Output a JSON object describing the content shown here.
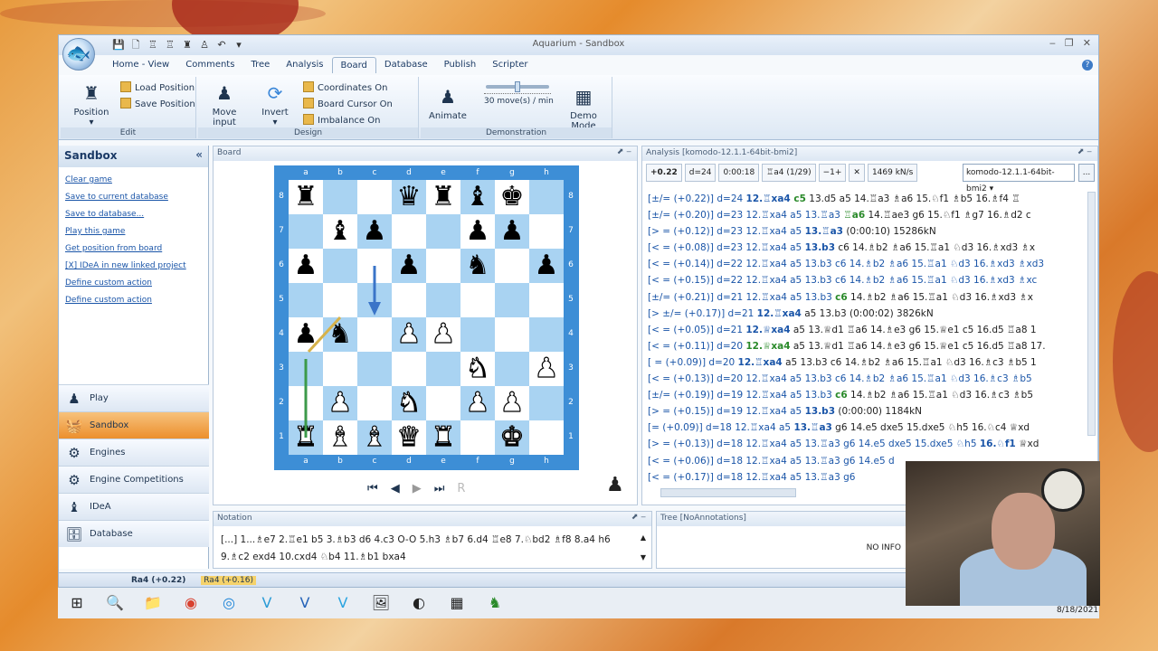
{
  "window": {
    "title": "Aquarium - Sandbox",
    "min": "‒",
    "max": "❐",
    "close": "✕"
  },
  "quick_access": [
    "💾",
    "🗋",
    "♖",
    "♖",
    "♜",
    "♙",
    "↶",
    "▾"
  ],
  "tabs": [
    "Home - View",
    "Comments",
    "Tree",
    "Analysis",
    "Board",
    "Database",
    "Publish",
    "Scripter"
  ],
  "active_tab": "Board",
  "ribbon": {
    "edit": {
      "label": "Edit",
      "position": "Position",
      "load": "Load Position",
      "save": "Save Position"
    },
    "design": {
      "label": "Design",
      "move_input": "Move input",
      "invert": "Invert",
      "coords": "Coordinates On",
      "cursor": "Board Cursor On",
      "imbalance": "Imbalance On"
    },
    "demonstration": {
      "label": "Demonstration",
      "animate": "Animate",
      "speed": "30 move(s) / min",
      "speed_fraction": 0.5,
      "demo": "Demo Mode"
    }
  },
  "sidebar": {
    "title": "Sandbox",
    "tasks": [
      "Clear game",
      "Save to current database",
      "Save to database...",
      "Play this game",
      "Get position from board",
      "[X] IDeA in new linked project",
      "Define custom action",
      "Define custom action"
    ],
    "nav": [
      {
        "label": "Play",
        "icon": "♟"
      },
      {
        "label": "Sandbox",
        "icon": "🧺"
      },
      {
        "label": "Engines",
        "icon": "⚙"
      },
      {
        "label": "Engine Competitions",
        "icon": "⚙"
      },
      {
        "label": "IDeA",
        "icon": "♝"
      },
      {
        "label": "Database",
        "icon": "🗄"
      }
    ]
  },
  "board_panel": {
    "title": "Board",
    "files": [
      "a",
      "b",
      "c",
      "d",
      "e",
      "f",
      "g",
      "h"
    ],
    "ranks": [
      "8",
      "7",
      "6",
      "5",
      "4",
      "3",
      "2",
      "1"
    ],
    "position": [
      [
        "r",
        "",
        "",
        "q",
        "r",
        "b",
        "k",
        ""
      ],
      [
        "",
        "b",
        "p",
        "",
        "",
        "p",
        "p",
        ""
      ],
      [
        "p",
        "",
        "",
        "p",
        "",
        "n",
        "",
        "p"
      ],
      [
        "",
        "",
        "",
        "",
        "",
        "",
        "",
        ""
      ],
      [
        "p",
        "n",
        "",
        "P",
        "P",
        "",
        "",
        ""
      ],
      [
        "",
        "",
        "",
        "",
        "",
        "N",
        "",
        "P"
      ],
      [
        "",
        "P",
        "",
        "N",
        "",
        "P",
        "P",
        ""
      ],
      [
        "R",
        "B",
        "B",
        "Q",
        "R",
        "",
        "K",
        ""
      ]
    ],
    "nav": [
      "⏮",
      "◀",
      "▶",
      "⏭",
      "R"
    ]
  },
  "analysis": {
    "title": "Analysis [komodo-12.1.1-64bit-bmi2]",
    "score": "+0.22",
    "depth": "d=24",
    "time": "0:00:18",
    "move": "♖a4 (1/29)",
    "eval": "−1+",
    "close": "✕",
    "speed": "1469 kN/s",
    "engine": "komodo-12.1.1-64bit-bmi2 ▾",
    "more": "...",
    "lines": [
      [
        "[±/= (+0.22)] d=24 ",
        "12.♖xa4 ",
        "c5",
        " 13.d5 a5 14.♖a3 ♗a6 15.♘f1 ♗b5 16.♗f4 ♖"
      ],
      [
        "[±/= (+0.20)] d=23 12.♖xa4 a5 13.♖a3 ",
        "",
        "♖a6",
        " 14.♖ae3 g6 15.♘f1 ♗g7 16.♗d2 c"
      ],
      [
        "[> = (+0.12)] d=23 12.♖xa4 a5 ",
        "13.♖a3",
        "",
        "",
        " (0:00:10) 15286kN"
      ],
      [
        "[< = (+0.08)] d=23 12.♖xa4 a5 ",
        "13.b3",
        "",
        "",
        " c6 14.♗b2 ♗a6 15.♖a1 ♘d3 16.♗xd3 ♗x"
      ],
      [
        "[< = (+0.14)] d=22 12.♖xa4 a5 13.b3 c6 14.♗b2 ♗a6 15.♖a1 ♘d3 16.♗xd3 ♗xd3",
        "",
        "",
        ""
      ],
      [
        "[< = (+0.15)] d=22 12.♖xa4 a5 13.b3 c6 14.♗b2 ♗a6 15.♖a1 ♘d3 16.♗xd3 ♗xc",
        "",
        "",
        ""
      ],
      [
        "[±/= (+0.21)] d=21 12.♖xa4 a5 13.b3 ",
        "",
        "c6",
        " 14.♗b2 ♗a6 15.♖a1 ♘d3 16.♗xd3 ♗x"
      ],
      [
        "[> ±/= (+0.17)] d=21 ",
        "12.♖xa4",
        "",
        "",
        " a5 13.b3 (0:00:02) 3826kN"
      ],
      [
        "[< = (+0.05)] d=21 ",
        "12.♕xa4",
        "",
        "",
        " a5 13.♕d1 ♖a6 14.♗e3 g6 15.♕e1 c5 16.d5 ♖a8 1"
      ],
      [
        "[< = (+0.11)] d=20 ",
        "",
        "12.♕xa4",
        " a5 13.♕d1 ♖a6 14.♗e3 g6 15.♕e1 c5 16.d5 ♖a8 17."
      ],
      [
        "[ = (+0.09)] d=20 ",
        "12.♖xa4",
        "",
        "",
        " a5 13.b3 c6 14.♗b2 ♗a6 15.♖a1 ♘d3 16.♗c3 ♗b5 1"
      ],
      [
        "[< = (+0.13)] d=20 12.♖xa4 a5 13.b3 c6 14.♗b2 ♗a6 15.♖a1 ♘d3 16.♗c3 ♗b5",
        "",
        "",
        ""
      ],
      [
        "[±/= (+0.19)] d=19 12.♖xa4 a5 13.b3 ",
        "",
        "c6",
        " 14.♗b2 ♗a6 15.♖a1 ♘d3 16.♗c3 ♗b5"
      ],
      [
        "[> = (+0.15)] d=19 12.♖xa4 a5 ",
        "13.b3",
        "",
        "",
        " (0:00:00) 1184kN"
      ],
      [
        "[= (+0.09)] d=18 12.♖xa4 a5 ",
        "13.♖a3",
        "",
        "",
        " g6 14.e5 dxe5 15.dxe5 ♘h5 16.♘c4 ♕xd"
      ],
      [
        "[> = (+0.13)] d=18 12.♖xa4 a5 13.♖a3 g6 14.e5 dxe5 15.dxe5 ♘h5 ",
        "16.♘f1",
        "",
        "",
        " ♕xd"
      ],
      [
        "[< = (+0.06)] d=18 12.♖xa4 a5 13.♖a3 g6 14.e5 d",
        "",
        "",
        ""
      ],
      [
        "[< = (+0.17)] d=18 12.♖xa4 a5 13.♖a3 g6",
        "",
        "",
        ""
      ]
    ]
  },
  "notation": {
    "title": "Notation",
    "text": "[...] 1...♗e7 2.♖e1 b5 3.♗b3 d6 4.c3 O-O 5.h3 ♗b7 6.d4 ♖e8 7.♘bd2 ♗f8 8.a4 h6 9.♗c2 exd4 10.cxd4 ♘b4 11.♗b1 bxa4",
    "scroll_up": "▲",
    "scroll_down": "▼"
  },
  "tree": {
    "title": "Tree [NoAnnotations]",
    "info": "NO INFO"
  },
  "status": {
    "item1": "Ra4 (+0.22)",
    "item2": "Ra4 (+0.16)"
  },
  "taskbar": [
    "⊞",
    "🔍",
    "📁",
    "◉",
    "◎",
    "V",
    "V",
    "V",
    "🖼",
    "◐",
    "▦",
    "♞"
  ],
  "date": "8/18/2021"
}
